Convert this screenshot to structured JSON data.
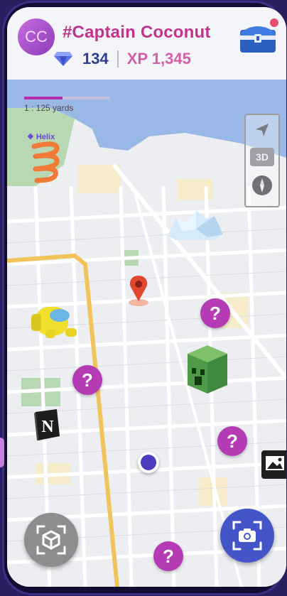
{
  "header": {
    "avatar_initials": "CC",
    "username": "#Captain Coconut",
    "gems": "134",
    "xp": "XP 1,345",
    "has_notification": true
  },
  "map": {
    "scale_label": "1 : 125 yards",
    "scale_progress_fraction": 0.45,
    "location_label": "❖ Helix",
    "controls": {
      "compass": "navigation-arrow-icon",
      "mode_3d": "3D",
      "north": "compass-icon"
    },
    "objects": [
      {
        "name": "helix-spring",
        "type": "3d-object"
      },
      {
        "name": "iceberg",
        "type": "3d-object"
      },
      {
        "name": "location-pin",
        "type": "3d-object"
      },
      {
        "name": "among-us-crewmate",
        "type": "3d-object"
      },
      {
        "name": "creeper-cube",
        "type": "3d-object"
      },
      {
        "name": "notion-logo",
        "type": "3d-object"
      },
      {
        "name": "image-card",
        "type": "3d-object"
      }
    ],
    "mystery_markers": [
      "?",
      "?",
      "?",
      "?"
    ]
  },
  "actions": {
    "ar_button": "cube-scan-icon",
    "camera_button": "camera-scan-icon"
  },
  "colors": {
    "accent_pink": "#c2338d",
    "gem_blue": "#2d3f8f",
    "marker_purple": "#b53bb5",
    "camera_blue": "#4355c8"
  }
}
